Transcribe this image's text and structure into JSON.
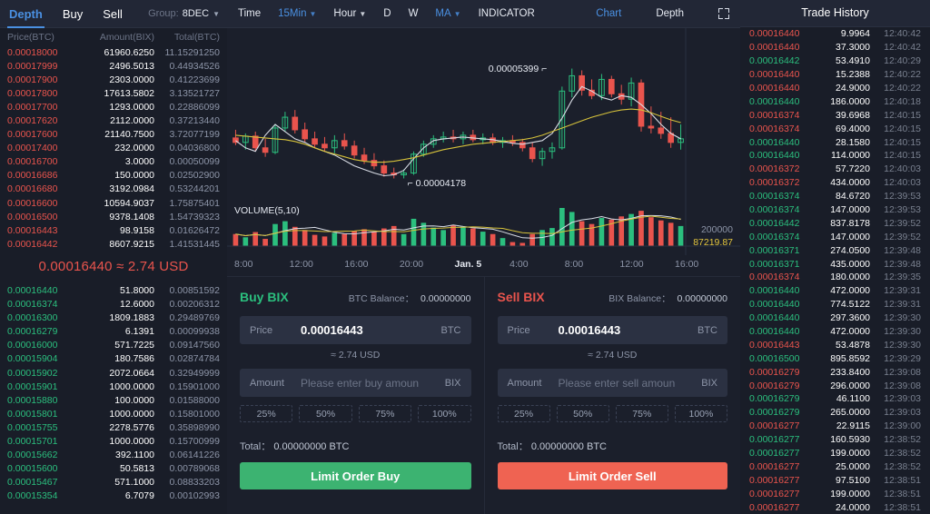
{
  "orderbook": {
    "tabs": [
      {
        "label": "Depth",
        "active": true
      },
      {
        "label": "Buy",
        "active": false
      },
      {
        "label": "Sell",
        "active": false
      }
    ],
    "group": {
      "label": "Group:",
      "value": "8DEC",
      "caret": "chevron-down-icon"
    },
    "columns": [
      "Price(BTC)",
      "Amount(BIX)",
      "Total(BTC)"
    ],
    "last_price": "0.00016440 ≈ 2.74 USD",
    "asks": [
      [
        "0.00018000",
        "61960.6250",
        "11.15291250"
      ],
      [
        "0.00017999",
        "2496.5013",
        "0.44934526"
      ],
      [
        "0.00017900",
        "2303.0000",
        "0.41223699"
      ],
      [
        "0.00017800",
        "17613.5802",
        "3.13521727"
      ],
      [
        "0.00017700",
        "1293.0000",
        "0.22886099"
      ],
      [
        "0.00017620",
        "2112.0000",
        "0.37213440"
      ],
      [
        "0.00017600",
        "21140.7500",
        "3.72077199"
      ],
      [
        "0.00017400",
        "232.0000",
        "0.04036800"
      ],
      [
        "0.00016700",
        "3.0000",
        "0.00050099"
      ],
      [
        "0.00016686",
        "150.0000",
        "0.02502900"
      ],
      [
        "0.00016680",
        "3192.0984",
        "0.53244201"
      ],
      [
        "0.00016600",
        "10594.9037",
        "1.75875401"
      ],
      [
        "0.00016500",
        "9378.1408",
        "1.54739323"
      ],
      [
        "0.00016443",
        "98.9158",
        "0.01626472"
      ],
      [
        "0.00016442",
        "8607.9215",
        "1.41531445"
      ]
    ],
    "bids": [
      [
        "0.00016440",
        "51.8000",
        "0.00851592"
      ],
      [
        "0.00016374",
        "12.6000",
        "0.00206312"
      ],
      [
        "0.00016300",
        "1809.1883",
        "0.29489769"
      ],
      [
        "0.00016279",
        "6.1391",
        "0.00099938"
      ],
      [
        "0.00016000",
        "571.7225",
        "0.09147560"
      ],
      [
        "0.00015904",
        "180.7586",
        "0.02874784"
      ],
      [
        "0.00015902",
        "2072.0664",
        "0.32949999"
      ],
      [
        "0.00015901",
        "1000.0000",
        "0.15901000"
      ],
      [
        "0.00015880",
        "100.0000",
        "0.01588000"
      ],
      [
        "0.00015801",
        "1000.0000",
        "0.15801000"
      ],
      [
        "0.00015755",
        "2278.5776",
        "0.35898990"
      ],
      [
        "0.00015701",
        "1000.0000",
        "0.15700999"
      ],
      [
        "0.00015662",
        "392.1100",
        "0.06141226"
      ],
      [
        "0.00015600",
        "50.5813",
        "0.00789068"
      ],
      [
        "0.00015467",
        "571.1000",
        "0.08833203"
      ],
      [
        "0.00015354",
        "6.7079",
        "0.00102993"
      ]
    ]
  },
  "chart_toolbar": {
    "left": [
      {
        "label": "Time",
        "caret": false,
        "blue": false
      },
      {
        "label": "15Min",
        "caret": true,
        "blue": true
      },
      {
        "label": "Hour",
        "caret": true,
        "blue": false
      },
      {
        "label": "D",
        "caret": false,
        "blue": false
      },
      {
        "label": "W",
        "caret": false,
        "blue": false
      },
      {
        "label": "MA",
        "caret": true,
        "blue": true
      },
      {
        "label": "INDICATOR",
        "caret": false,
        "blue": false
      }
    ],
    "right": [
      {
        "label": "Chart",
        "blue": true
      },
      {
        "label": "Depth",
        "blue": false
      }
    ],
    "fullscreen_icon": "fullscreen-icon"
  },
  "chart_data": {
    "type": "line",
    "title": "",
    "high_label": "0.00005399",
    "low_label": "0.00004178",
    "volume_title": "VOLUME(5,10)",
    "volume_scale": "200000",
    "volume_value": "87219.87",
    "xlabel": "",
    "ylabel": "",
    "ylim": [
      4.178e-05,
      5.399e-05
    ],
    "grid": false,
    "legend": "",
    "tick_labels": [
      "8:00",
      "12:00",
      "16:00",
      "20:00",
      "Jan. 5",
      "4:00",
      "8:00",
      "12:00",
      "16:00"
    ],
    "colors": {
      "up": "#2bbf7e",
      "down": "#e9544d",
      "ma_short": "#d9dde6",
      "ma_long": "#d6c23b"
    },
    "series": [
      {
        "name": "MA5",
        "values": [
          4.6e-05,
          4.52e-05,
          4.48e-05,
          4.66e-05,
          4.78e-05,
          4.7e-05,
          4.62e-05,
          4.58e-05,
          4.52e-05,
          4.48e-05,
          4.44e-05,
          4.38e-05,
          4.32e-05,
          4.28e-05,
          4.24e-05,
          4.21e-05,
          4.22e-05,
          4.27e-05,
          4.4e-05,
          4.52e-05,
          4.6e-05,
          4.62e-05,
          4.63e-05,
          4.64e-05,
          4.63e-05,
          4.62e-05,
          4.61e-05,
          4.59e-05,
          4.57e-05,
          4.56e-05,
          4.58e-05,
          4.6e-05,
          4.68e-05,
          4.85e-05,
          5.05e-05,
          5.2e-05,
          5.15e-05,
          5.08e-05,
          5.05e-05,
          5.1e-05,
          5.08e-05,
          5e-05,
          4.9e-05,
          4.78e-05,
          4.68e-05,
          4.62e-05
        ]
      },
      {
        "name": "MA10",
        "values": [
          4.66e-05,
          4.65e-05,
          4.64e-05,
          4.63e-05,
          4.62e-05,
          4.61e-05,
          4.59e-05,
          4.56e-05,
          4.52e-05,
          4.48e-05,
          4.45e-05,
          4.42e-05,
          4.39e-05,
          4.37e-05,
          4.36e-05,
          4.36e-05,
          4.37e-05,
          4.39e-05,
          4.41e-05,
          4.44e-05,
          4.47e-05,
          4.5e-05,
          4.52e-05,
          4.54e-05,
          4.56e-05,
          4.57e-05,
          4.58e-05,
          4.59e-05,
          4.6e-05,
          4.61e-05,
          4.63e-05,
          4.66e-05,
          4.7e-05,
          4.74e-05,
          4.78e-05,
          4.82e-05,
          4.86e-05,
          4.89e-05,
          4.92e-05,
          4.94e-05,
          4.95e-05,
          4.94e-05,
          4.91e-05,
          4.87e-05,
          4.83e-05,
          4.8e-05
        ]
      }
    ],
    "candles": [
      {
        "o": 4.63e-05,
        "h": 4.72e-05,
        "l": 4.55e-05,
        "c": 4.58e-05,
        "v": 0.3
      },
      {
        "o": 4.58e-05,
        "h": 4.68e-05,
        "l": 4.5e-05,
        "c": 4.65e-05,
        "v": 0.22
      },
      {
        "o": 4.65e-05,
        "h": 4.7e-05,
        "l": 4.48e-05,
        "c": 4.52e-05,
        "v": 0.35
      },
      {
        "o": 4.52e-05,
        "h": 4.62e-05,
        "l": 4.42e-05,
        "c": 4.47e-05,
        "v": 0.18
      },
      {
        "o": 4.47e-05,
        "h": 4.78e-05,
        "l": 4.45e-05,
        "c": 4.74e-05,
        "v": 0.55
      },
      {
        "o": 4.74e-05,
        "h": 4.92e-05,
        "l": 4.7e-05,
        "c": 4.86e-05,
        "v": 0.62
      },
      {
        "o": 4.86e-05,
        "h": 4.94e-05,
        "l": 4.68e-05,
        "c": 4.72e-05,
        "v": 0.48
      },
      {
        "o": 4.72e-05,
        "h": 4.8e-05,
        "l": 4.58e-05,
        "c": 4.62e-05,
        "v": 0.4
      },
      {
        "o": 4.62e-05,
        "h": 4.7e-05,
        "l": 4.52e-05,
        "c": 4.56e-05,
        "v": 0.28
      },
      {
        "o": 4.56e-05,
        "h": 4.64e-05,
        "l": 4.48e-05,
        "c": 4.52e-05,
        "v": 0.24
      },
      {
        "o": 4.52e-05,
        "h": 4.66e-05,
        "l": 4.46e-05,
        "c": 4.6e-05,
        "v": 0.33
      },
      {
        "o": 4.6e-05,
        "h": 4.68e-05,
        "l": 4.5e-05,
        "c": 4.54e-05,
        "v": 0.3
      },
      {
        "o": 4.54e-05,
        "h": 4.6e-05,
        "l": 4.4e-05,
        "c": 4.44e-05,
        "v": 0.38
      },
      {
        "o": 4.44e-05,
        "h": 4.52e-05,
        "l": 4.34e-05,
        "c": 4.38e-05,
        "v": 0.42
      },
      {
        "o": 4.38e-05,
        "h": 4.46e-05,
        "l": 4.28e-05,
        "c": 4.32e-05,
        "v": 0.35
      },
      {
        "o": 4.32e-05,
        "h": 4.38e-05,
        "l": 4.2e-05,
        "c": 4.24e-05,
        "v": 0.44
      },
      {
        "o": 4.24e-05,
        "h": 4.3e-05,
        "l": 4.18e-05,
        "c": 4.22e-05,
        "v": 0.5
      },
      {
        "o": 4.22e-05,
        "h": 4.28e-05,
        "l": 4.18e-05,
        "c": 4.24e-05,
        "v": 0.3
      },
      {
        "o": 4.24e-05,
        "h": 4.48e-05,
        "l": 4.22e-05,
        "c": 4.45e-05,
        "v": 0.68
      },
      {
        "o": 4.45e-05,
        "h": 4.6e-05,
        "l": 4.42e-05,
        "c": 4.56e-05,
        "v": 0.58
      },
      {
        "o": 4.56e-05,
        "h": 4.66e-05,
        "l": 4.52e-05,
        "c": 4.62e-05,
        "v": 0.46
      },
      {
        "o": 4.62e-05,
        "h": 4.7e-05,
        "l": 4.58e-05,
        "c": 4.64e-05,
        "v": 0.4
      },
      {
        "o": 4.64e-05,
        "h": 4.72e-05,
        "l": 4.58e-05,
        "c": 4.62e-05,
        "v": 0.52
      },
      {
        "o": 4.62e-05,
        "h": 4.7e-05,
        "l": 4.56e-05,
        "c": 4.66e-05,
        "v": 0.48
      },
      {
        "o": 4.66e-05,
        "h": 4.72e-05,
        "l": 4.58e-05,
        "c": 4.61e-05,
        "v": 0.44
      },
      {
        "o": 4.61e-05,
        "h": 4.68e-05,
        "l": 4.56e-05,
        "c": 4.63e-05,
        "v": 0.36
      },
      {
        "o": 4.63e-05,
        "h": 4.68e-05,
        "l": 4.55e-05,
        "c": 4.58e-05,
        "v": 0.3
      },
      {
        "o": 4.58e-05,
        "h": 4.64e-05,
        "l": 4.52e-05,
        "c": 4.6e-05,
        "v": 0.2
      },
      {
        "o": 4.6e-05,
        "h": 4.66e-05,
        "l": 4.54e-05,
        "c": 4.58e-05,
        "v": 0.1
      },
      {
        "o": 4.58e-05,
        "h": 4.62e-05,
        "l": 4.48e-05,
        "c": 4.52e-05,
        "v": 0.08
      },
      {
        "o": 4.52e-05,
        "h": 4.58e-05,
        "l": 4.36e-05,
        "c": 4.4e-05,
        "v": 0.3
      },
      {
        "o": 4.4e-05,
        "h": 4.52e-05,
        "l": 4.32e-05,
        "c": 4.48e-05,
        "v": 0.4
      },
      {
        "o": 4.48e-05,
        "h": 4.58e-05,
        "l": 4.4e-05,
        "c": 4.52e-05,
        "v": 0.45
      },
      {
        "o": 4.52e-05,
        "h": 5.2e-05,
        "l": 4.5e-05,
        "c": 5.15e-05,
        "v": 0.95
      },
      {
        "o": 5.15e-05,
        "h": 5.4e-05,
        "l": 5.08e-05,
        "c": 5.32e-05,
        "v": 0.85
      },
      {
        "o": 5.32e-05,
        "h": 5.38e-05,
        "l": 5.1e-05,
        "c": 5.16e-05,
        "v": 0.62
      },
      {
        "o": 5.16e-05,
        "h": 5.28e-05,
        "l": 5.06e-05,
        "c": 5.1e-05,
        "v": 0.55
      },
      {
        "o": 5.1e-05,
        "h": 5.34e-05,
        "l": 5.05e-05,
        "c": 5.28e-05,
        "v": 0.7
      },
      {
        "o": 5.28e-05,
        "h": 5.32e-05,
        "l": 5.08e-05,
        "c": 5.12e-05,
        "v": 0.66
      },
      {
        "o": 5.12e-05,
        "h": 5.22e-05,
        "l": 5e-05,
        "c": 5.06e-05,
        "v": 0.74
      },
      {
        "o": 5.06e-05,
        "h": 5.3e-05,
        "l": 4.98e-05,
        "c": 5.24e-05,
        "v": 0.8
      },
      {
        "o": 5.24e-05,
        "h": 5.28e-05,
        "l": 4.7e-05,
        "c": 4.76e-05,
        "v": 0.88
      },
      {
        "o": 4.76e-05,
        "h": 4.98e-05,
        "l": 4.68e-05,
        "c": 4.74e-05,
        "v": 0.72
      },
      {
        "o": 4.74e-05,
        "h": 4.92e-05,
        "l": 4.62e-05,
        "c": 4.68e-05,
        "v": 0.64
      },
      {
        "o": 4.68e-05,
        "h": 4.86e-05,
        "l": 4.52e-05,
        "c": 4.58e-05,
        "v": 0.58
      },
      {
        "o": 4.58e-05,
        "h": 4.78e-05,
        "l": 4.5e-05,
        "c": 4.62e-05,
        "v": 0.5
      }
    ]
  },
  "buy_form": {
    "title": "Buy BIX",
    "balance_label": "BTC Balance：",
    "balance_value": "0.00000000",
    "price_label": "Price",
    "price_value": "0.00016443",
    "price_unit": "BTC",
    "usd": "≈ 2.74 USD",
    "amount_label": "Amount",
    "amount_placeholder": "Please enter buy amoun",
    "amount_unit": "BIX",
    "percents": [
      "25%",
      "50%",
      "75%",
      "100%"
    ],
    "total_label": "Total：",
    "total_value": "0.00000000 BTC",
    "submit": "Limit Order Buy"
  },
  "sell_form": {
    "title": "Sell BIX",
    "balance_label": "BIX Balance：",
    "balance_value": "0.00000000",
    "price_label": "Price",
    "price_value": "0.00016443",
    "price_unit": "BTC",
    "usd": "≈ 2.74 USD",
    "amount_label": "Amount",
    "amount_placeholder": "Please enter sell amoun",
    "amount_unit": "BIX",
    "percents": [
      "25%",
      "50%",
      "75%",
      "100%"
    ],
    "total_label": "Total：",
    "total_value": "0.00000000 BTC",
    "submit": "Limit Order Sell"
  },
  "trade_history": {
    "title": "Trade History",
    "rows": [
      {
        "price": "0.00016440",
        "amount": "9.9964",
        "time": "12:40:42",
        "dir": "down"
      },
      {
        "price": "0.00016440",
        "amount": "37.3000",
        "time": "12:40:42",
        "dir": "down"
      },
      {
        "price": "0.00016442",
        "amount": "53.4910",
        "time": "12:40:29",
        "dir": "up"
      },
      {
        "price": "0.00016440",
        "amount": "15.2388",
        "time": "12:40:22",
        "dir": "down"
      },
      {
        "price": "0.00016440",
        "amount": "24.9000",
        "time": "12:40:22",
        "dir": "down"
      },
      {
        "price": "0.00016440",
        "amount": "186.0000",
        "time": "12:40:18",
        "dir": "up"
      },
      {
        "price": "0.00016374",
        "amount": "39.6968",
        "time": "12:40:15",
        "dir": "down"
      },
      {
        "price": "0.00016374",
        "amount": "69.4000",
        "time": "12:40:15",
        "dir": "down"
      },
      {
        "price": "0.00016440",
        "amount": "28.1580",
        "time": "12:40:15",
        "dir": "up"
      },
      {
        "price": "0.00016440",
        "amount": "114.0000",
        "time": "12:40:15",
        "dir": "up"
      },
      {
        "price": "0.00016372",
        "amount": "57.7220",
        "time": "12:40:03",
        "dir": "down"
      },
      {
        "price": "0.00016372",
        "amount": "434.0000",
        "time": "12:40:03",
        "dir": "down"
      },
      {
        "price": "0.00016374",
        "amount": "84.6720",
        "time": "12:39:53",
        "dir": "up"
      },
      {
        "price": "0.00016374",
        "amount": "147.0000",
        "time": "12:39:53",
        "dir": "up"
      },
      {
        "price": "0.00016442",
        "amount": "837.8178",
        "time": "12:39:52",
        "dir": "up"
      },
      {
        "price": "0.00016374",
        "amount": "147.0000",
        "time": "12:39:52",
        "dir": "up"
      },
      {
        "price": "0.00016371",
        "amount": "274.0500",
        "time": "12:39:48",
        "dir": "up"
      },
      {
        "price": "0.00016371",
        "amount": "435.0000",
        "time": "12:39:48",
        "dir": "up"
      },
      {
        "price": "0.00016374",
        "amount": "180.0000",
        "time": "12:39:35",
        "dir": "down"
      },
      {
        "price": "0.00016440",
        "amount": "472.0000",
        "time": "12:39:31",
        "dir": "up"
      },
      {
        "price": "0.00016440",
        "amount": "774.5122",
        "time": "12:39:31",
        "dir": "up"
      },
      {
        "price": "0.00016440",
        "amount": "297.3600",
        "time": "12:39:30",
        "dir": "up"
      },
      {
        "price": "0.00016440",
        "amount": "472.0000",
        "time": "12:39:30",
        "dir": "up"
      },
      {
        "price": "0.00016443",
        "amount": "53.4878",
        "time": "12:39:30",
        "dir": "down"
      },
      {
        "price": "0.00016500",
        "amount": "895.8592",
        "time": "12:39:29",
        "dir": "up"
      },
      {
        "price": "0.00016279",
        "amount": "233.8400",
        "time": "12:39:08",
        "dir": "down"
      },
      {
        "price": "0.00016279",
        "amount": "296.0000",
        "time": "12:39:08",
        "dir": "down"
      },
      {
        "price": "0.00016279",
        "amount": "46.1100",
        "time": "12:39:03",
        "dir": "up"
      },
      {
        "price": "0.00016279",
        "amount": "265.0000",
        "time": "12:39:03",
        "dir": "up"
      },
      {
        "price": "0.00016277",
        "amount": "22.9115",
        "time": "12:39:00",
        "dir": "down"
      },
      {
        "price": "0.00016277",
        "amount": "160.5930",
        "time": "12:38:52",
        "dir": "up"
      },
      {
        "price": "0.00016277",
        "amount": "199.0000",
        "time": "12:38:52",
        "dir": "up"
      },
      {
        "price": "0.00016277",
        "amount": "25.0000",
        "time": "12:38:52",
        "dir": "down"
      },
      {
        "price": "0.00016277",
        "amount": "97.5100",
        "time": "12:38:51",
        "dir": "down"
      },
      {
        "price": "0.00016277",
        "amount": "199.0000",
        "time": "12:38:51",
        "dir": "down"
      },
      {
        "price": "0.00016277",
        "amount": "24.0000",
        "time": "12:38:51",
        "dir": "down"
      }
    ]
  }
}
